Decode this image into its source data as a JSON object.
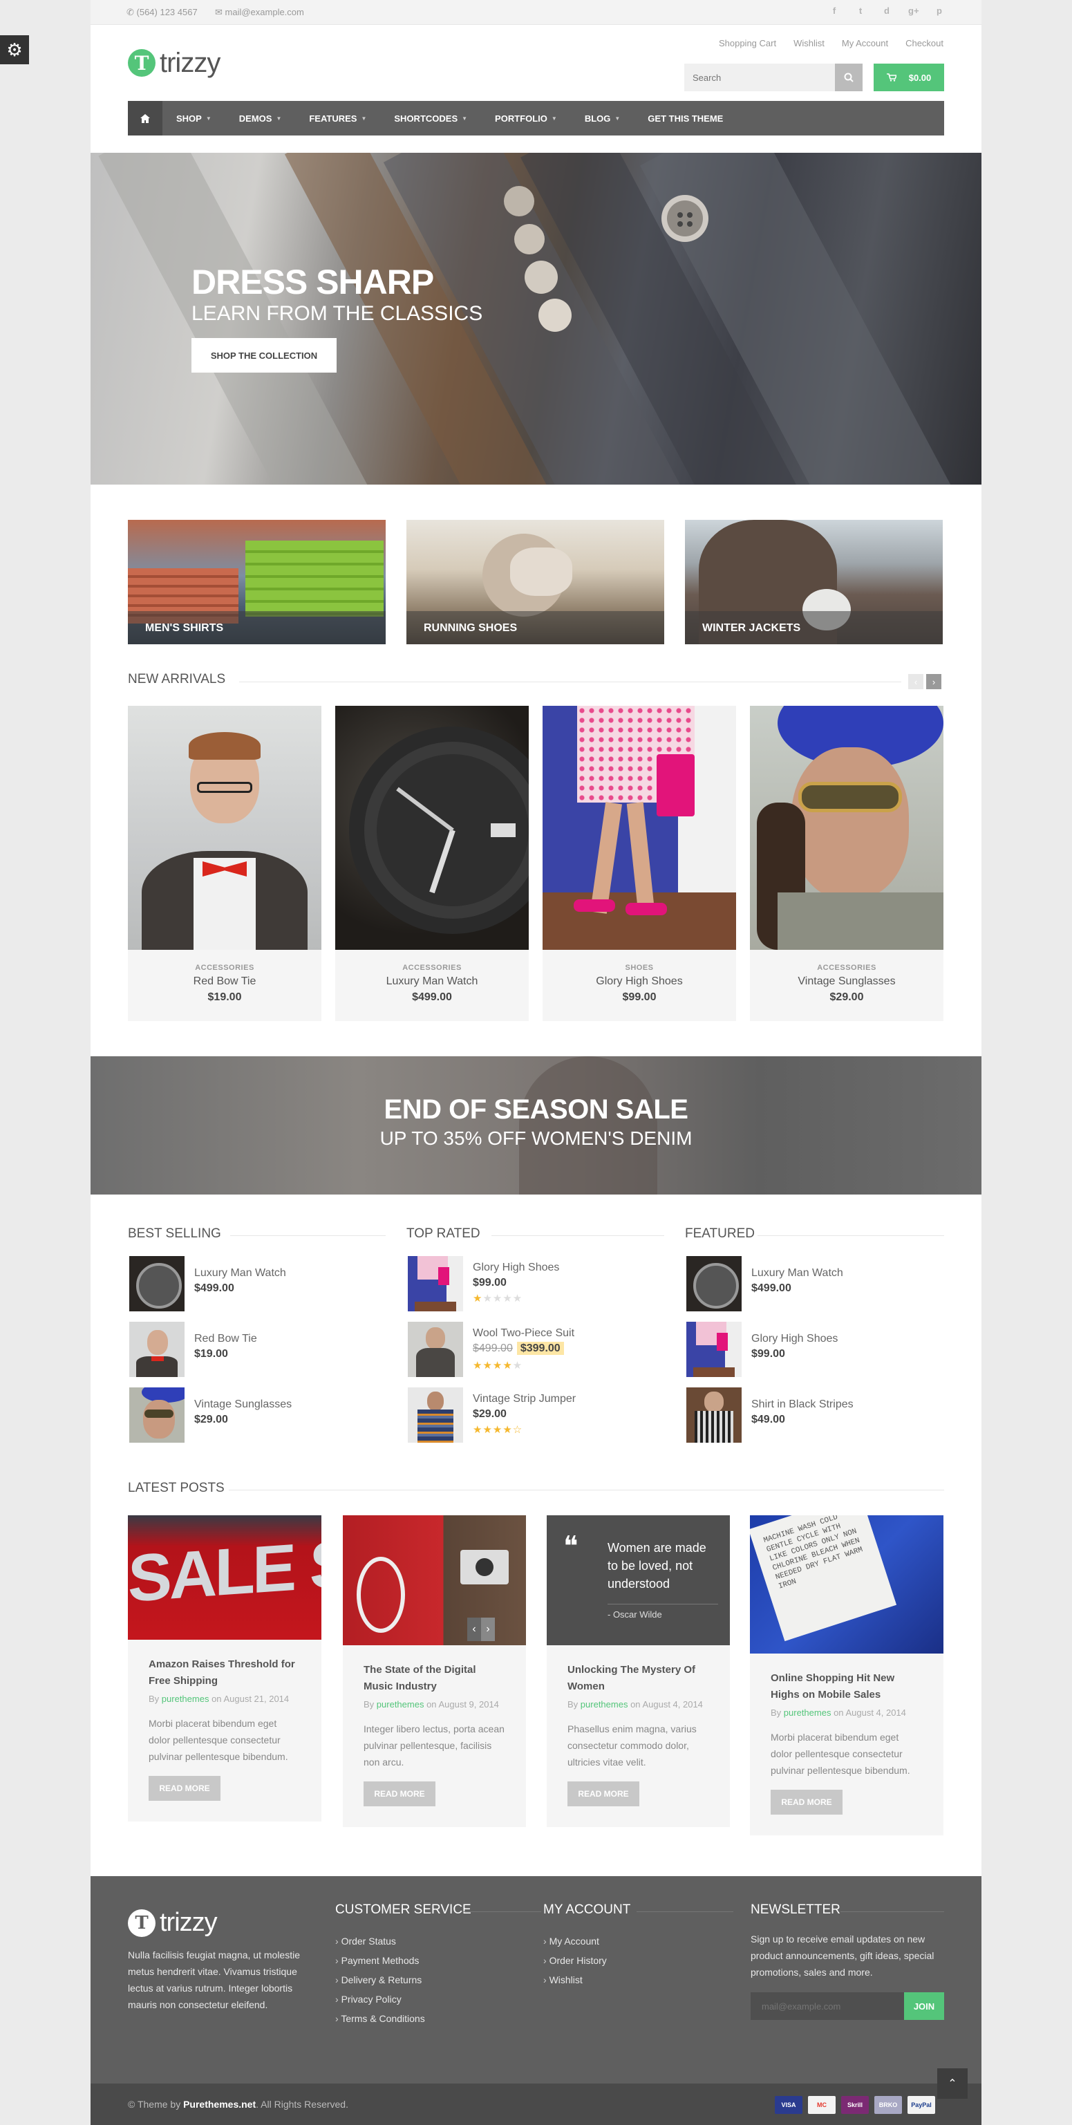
{
  "topbar": {
    "phone": "(564) 123 4567",
    "email": "mail@example.com",
    "social": [
      "f",
      "t",
      "d",
      "g+",
      "p"
    ]
  },
  "logo": {
    "mark": "T",
    "text": "trizzy"
  },
  "toplinks": [
    "Shopping Cart",
    "Wishlist",
    "My Account",
    "Checkout"
  ],
  "search": {
    "placeholder": "Search"
  },
  "cart": {
    "total": "$0.00"
  },
  "nav": [
    "SHOP",
    "DEMOS",
    "FEATURES",
    "SHORTCODES",
    "PORTFOLIO",
    "BLOG",
    "GET THIS THEME"
  ],
  "hero": {
    "title": "DRESS SHARP",
    "subtitle": "LEARN FROM THE CLASSICS",
    "button": "SHOP THE COLLECTION"
  },
  "categories": [
    "MEN'S SHIRTS",
    "RUNNING SHOES",
    "WINTER JACKETS"
  ],
  "new_arrivals": {
    "title": "NEW ARRIVALS",
    "products": [
      {
        "category": "ACCESSORIES",
        "name": "Red Bow Tie",
        "price": "$19.00"
      },
      {
        "category": "ACCESSORIES",
        "name": "Luxury Man Watch",
        "price": "$499.00"
      },
      {
        "category": "SHOES",
        "name": "Glory High Shoes",
        "price": "$99.00"
      },
      {
        "category": "ACCESSORIES",
        "name": "Vintage Sunglasses",
        "price": "$29.00"
      }
    ]
  },
  "sale_banner": {
    "title": "END OF SEASON SALE",
    "subtitle": "UP TO 35% OFF WOMEN'S DENIM"
  },
  "best_selling": {
    "title": "BEST SELLING",
    "items": [
      {
        "name": "Luxury Man Watch",
        "price": "$499.00"
      },
      {
        "name": "Red Bow Tie",
        "price": "$19.00"
      },
      {
        "name": "Vintage Sunglasses",
        "price": "$29.00"
      }
    ]
  },
  "top_rated": {
    "title": "TOP RATED",
    "items": [
      {
        "name": "Glory High Shoes",
        "price": "$99.00",
        "rating": 1
      },
      {
        "name": "Wool Two-Piece Suit",
        "old_price": "$499.00",
        "price": "$399.00",
        "rating": 4
      },
      {
        "name": "Vintage Strip Jumper",
        "price": "$29.00",
        "rating": 4.5
      }
    ]
  },
  "featured": {
    "title": "FEATURED",
    "items": [
      {
        "name": "Luxury Man Watch",
        "price": "$499.00"
      },
      {
        "name": "Glory High Shoes",
        "price": "$99.00"
      },
      {
        "name": "Shirt in Black Stripes",
        "price": "$49.00"
      }
    ]
  },
  "latest_posts": {
    "title": "LATEST POSTS",
    "by": "By",
    "author": "purethemes",
    "on": "on",
    "read_more": "READ MORE",
    "posts": [
      {
        "title": "Amazon Raises Threshold for Free Shipping",
        "date": "August 21, 2014",
        "excerpt": "Morbi placerat bibendum eget dolor pellentesque consectetur pulvinar pellentesque bibendum.",
        "image_text": "SALE SAL"
      },
      {
        "title": "The State of the Digital Music Industry",
        "date": "August 9, 2014",
        "excerpt": "Integer libero lectus, porta acean pulvinar pellentesque, facilisis non arcu."
      },
      {
        "title": "Unlocking The Mystery Of Women",
        "date": "August 4, 2014",
        "excerpt": "Phasellus enim magna, varius consectetur commodo dolor, ultricies vitae velit.",
        "quote": "Women are made to be loved, not understood",
        "quote_author": "- Oscar Wilde"
      },
      {
        "title": "Online Shopping Hit New Highs on Mobile Sales",
        "date": "August 4, 2014",
        "excerpt": "Morbi placerat bibendum eget dolor pellentesque consectetur pulvinar pellentesque bibendum.",
        "label_text": "MACHINE WASH COLD GENTLE CYCLE WITH LIKE COLORS ONLY NON CHLORINE BLEACH WHEN NEEDED DRY FLAT WARM IRON"
      }
    ]
  },
  "footer": {
    "about": "Nulla facilisis feugiat magna, ut molestie metus hendrerit vitae. Vivamus tristique lectus at varius rutrum. Integer lobortis mauris non consectetur eleifend.",
    "customer_service": {
      "title": "CUSTOMER SERVICE",
      "links": [
        "Order Status",
        "Payment Methods",
        "Delivery & Returns",
        "Privacy Policy",
        "Terms & Conditions"
      ]
    },
    "my_account": {
      "title": "MY ACCOUNT",
      "links": [
        "My Account",
        "Order History",
        "Wishlist"
      ]
    },
    "newsletter": {
      "title": "NEWSLETTER",
      "text": "Sign up to receive email updates on new product announcements, gift ideas, special promotions, sales and more.",
      "placeholder": "mail@example.com",
      "button": "JOIN"
    },
    "copyright_prefix": "© Theme by",
    "copyright_brand": "Purethemes.net",
    "copyright_suffix": ". All Rights Reserved.",
    "cards": [
      "VISA",
      "MC",
      "Skrill",
      "BRKO",
      "PayPal"
    ]
  }
}
